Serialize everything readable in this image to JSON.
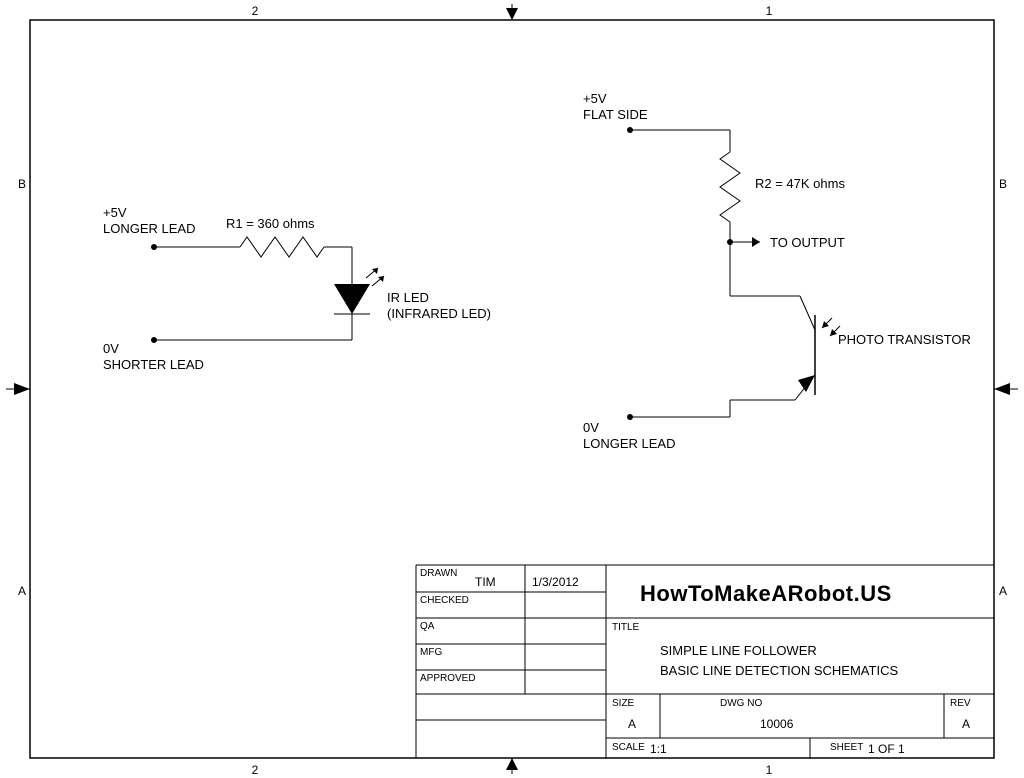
{
  "border": {
    "top": {
      "left": "2",
      "right": "1"
    },
    "bottom": {
      "left": "2",
      "right": "1"
    },
    "left": {
      "top": "B",
      "bottom": "A"
    },
    "right": {
      "top": "B",
      "bottom": "A"
    }
  },
  "circuit1": {
    "plus": "+5V",
    "plus_note": "LONGER LEAD",
    "r1": "R1 = 360 ohms",
    "led1": "IR LED",
    "led2": "(INFRARED LED)",
    "zero": "0V",
    "zero_note": "SHORTER LEAD"
  },
  "circuit2": {
    "plus": "+5V",
    "plus_note": "FLAT SIDE",
    "r2": "R2 = 47K ohms",
    "out": "TO OUTPUT",
    "pt": "PHOTO TRANSISTOR",
    "zero": "0V",
    "zero_note": "LONGER LEAD"
  },
  "titleblock": {
    "drawn_lbl": "DRAWN",
    "drawn_name": "TIM",
    "drawn_date": "1/3/2012",
    "checked": "CHECKED",
    "qa": "QA",
    "mfg": "MFG",
    "approved": "APPROVED",
    "site": "HowToMakeARobot.US",
    "title_lbl": "TITLE",
    "title1": "SIMPLE LINE FOLLOWER",
    "title2": "BASIC LINE DETECTION SCHEMATICS",
    "size_lbl": "SIZE",
    "size": "A",
    "dwg_lbl": "DWG NO",
    "dwg": "10006",
    "rev_lbl": "REV",
    "rev": "A",
    "scale_lbl": "SCALE",
    "scale": "1:1",
    "sheet_lbl": "SHEET",
    "sheet": "1 OF 1"
  }
}
